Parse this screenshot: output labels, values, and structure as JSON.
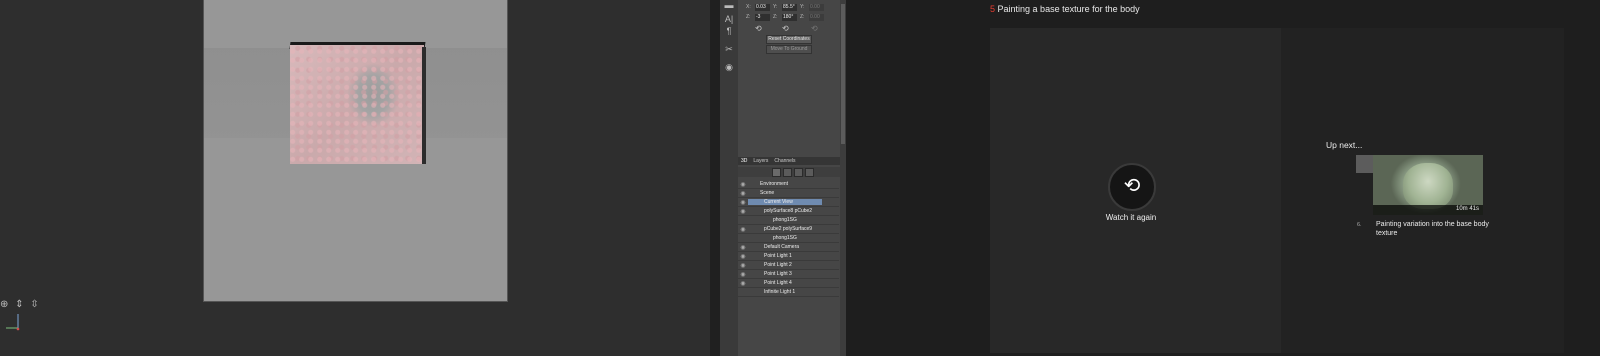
{
  "viewport": {
    "tool_icons": "⊕ ⇕ ⇳"
  },
  "ps_panel": {
    "coords": [
      {
        "x_label": "X:",
        "x_val": "0.03",
        "y_label": "Y:",
        "y_val": "85.5°",
        "z_label": "Y:",
        "z_val": "0.00"
      },
      {
        "x_label": "Z:",
        "x_val": "-3",
        "y_label": "Z:",
        "y_val": "180°",
        "z_label": "Z:",
        "z_val": "0.00"
      }
    ],
    "reset_button": "Reset Coordinates",
    "ground_button": "Move To Ground",
    "tabs": [
      "3D",
      "Layers",
      "Channels"
    ],
    "layers": [
      {
        "label": "Environment"
      },
      {
        "label": "Scene"
      },
      {
        "label": "Current View"
      },
      {
        "label": "polySurface8 pCube2"
      },
      {
        "label": "phong1SG"
      },
      {
        "label": "pCube2 polySurface9"
      },
      {
        "label": "phong1SG"
      },
      {
        "label": "Default Camera"
      },
      {
        "label": "Point Light 1"
      },
      {
        "label": "Point Light 2"
      },
      {
        "label": "Point Light 3"
      },
      {
        "label": "Point Light 4"
      },
      {
        "label": "Infinite Light 1"
      }
    ]
  },
  "player": {
    "lesson_number": "5",
    "lesson_title": "Painting a base texture for the body",
    "replay_label": "Watch it again",
    "up_next_title": "Up next...",
    "next_duration": "10m 41s",
    "next_number": "6.",
    "next_title": "Painting variation into the base body texture"
  },
  "colors": {
    "accent": "#e53a2f",
    "selected_layer": "#6f8bb0"
  }
}
